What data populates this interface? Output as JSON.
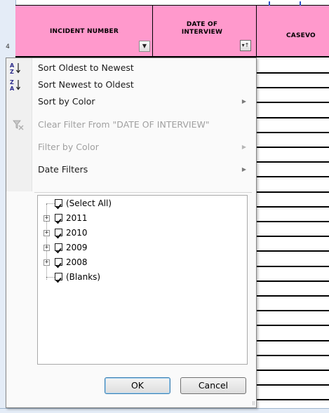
{
  "sheet": {
    "row_number": "4",
    "headers": [
      {
        "label": "INCIDENT NUMBER",
        "filter_icon": "dropdown-arrow"
      },
      {
        "label": "DATE OF INTERVIEW",
        "filter_icon": "filter-sorted-arrow"
      },
      {
        "label": "CASEVO"
      }
    ],
    "header_color": "#ff99cc"
  },
  "menu": {
    "sort_items": [
      {
        "label": "Sort Oldest to Newest",
        "icon": "sort-ascending-icon",
        "enabled": true
      },
      {
        "label": "Sort Newest to Oldest",
        "icon": "sort-descending-icon",
        "enabled": true
      },
      {
        "label": "Sort by Color",
        "enabled": true,
        "submenu": true
      }
    ],
    "clear_filter": {
      "label": "Clear Filter From \"DATE OF INTERVIEW\"",
      "icon": "clear-filter-icon",
      "enabled": false
    },
    "filter_by_color": {
      "label": "Filter by Color",
      "enabled": false,
      "submenu": true
    },
    "date_filters": {
      "label": "Date Filters",
      "enabled": true,
      "submenu": true
    },
    "submenu_arrow": "▶"
  },
  "tree": {
    "items": [
      {
        "label": "(Select All)",
        "checked": true,
        "expandable": false
      },
      {
        "label": "2011",
        "checked": true,
        "expandable": true
      },
      {
        "label": "2010",
        "checked": true,
        "expandable": true
      },
      {
        "label": "2009",
        "checked": true,
        "expandable": true
      },
      {
        "label": "2008",
        "checked": true,
        "expandable": true
      },
      {
        "label": "(Blanks)",
        "checked": true,
        "expandable": false
      }
    ],
    "expander_symbol": "+"
  },
  "buttons": {
    "ok_label": "OK",
    "cancel_label": "Cancel"
  }
}
